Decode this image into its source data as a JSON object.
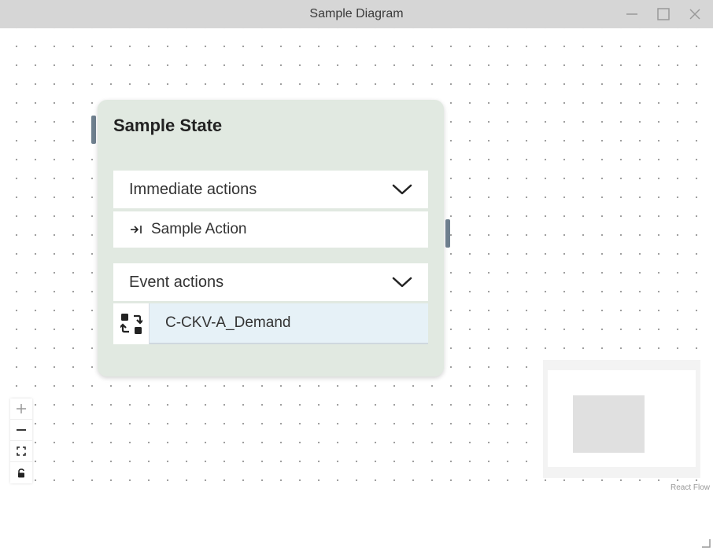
{
  "window": {
    "title": "Sample Diagram",
    "controls": {
      "minimize_icon": "minimize-icon",
      "maximize_icon": "maximize-icon",
      "close_icon": "close-icon"
    }
  },
  "node": {
    "title": "Sample State",
    "background_color": "#e1e9e1",
    "immediate_actions": {
      "header": "Immediate actions",
      "expand_icon": "chevron-down-icon",
      "items": [
        {
          "icon": "arrow-to-line-icon",
          "label": "Sample Action"
        }
      ]
    },
    "event_actions": {
      "header": "Event actions",
      "expand_icon": "chevron-down-icon",
      "items": [
        {
          "icon": "swap-icon",
          "value": "C-CKV-A_Demand",
          "background_color": "#e6f1f7"
        }
      ]
    }
  },
  "controls": [
    {
      "name": "zoom-in-button",
      "icon": "plus-icon"
    },
    {
      "name": "zoom-out-button",
      "icon": "minus-icon"
    },
    {
      "name": "fit-view-button",
      "icon": "fit-view-icon"
    },
    {
      "name": "lock-button",
      "icon": "lock-icon"
    }
  ],
  "attribution": "React Flow",
  "colors": {
    "handle": "#6e7f8e",
    "titlebar": "#d6d6d6",
    "minimap_bg": "#f3f3f3"
  }
}
